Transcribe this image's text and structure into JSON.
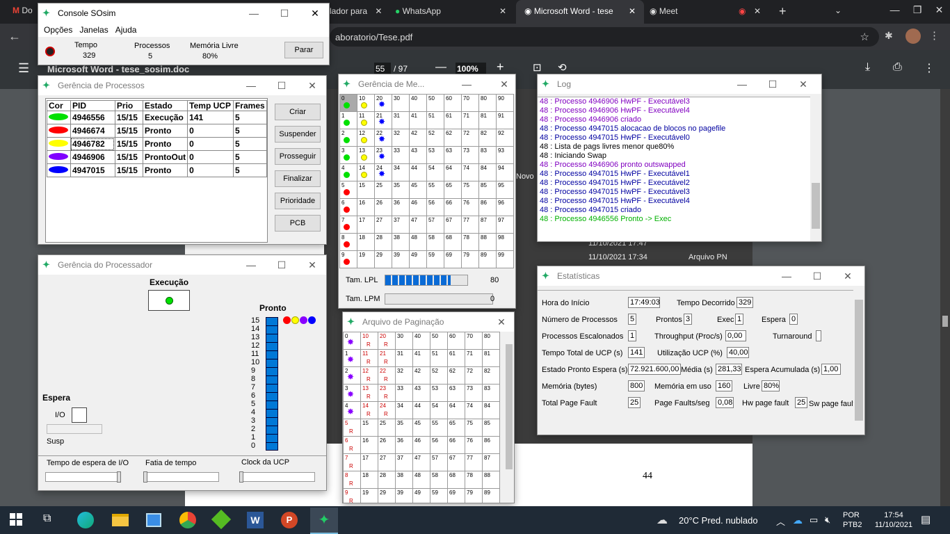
{
  "browser": {
    "tabs": [
      {
        "label": "Do"
      },
      {
        "label": "lador para"
      },
      {
        "label": "WhatsApp"
      },
      {
        "label": "Microsoft Word - tese"
      },
      {
        "label": "Meet"
      }
    ],
    "address": "aboratorio/Tese.pdf",
    "pdf": {
      "title": "Microsoft Word - tese_sosim.doc",
      "page": "55",
      "total": "/ 97",
      "zoom": "100%",
      "page_number": "44"
    }
  },
  "console": {
    "title": "Console SOsim",
    "menu": [
      "Opções",
      "Janelas",
      "Ajuda"
    ],
    "tempo_label": "Tempo",
    "tempo": "329",
    "processos_label": "Processos",
    "processos": "5",
    "memoria_label": "Memória Livre",
    "memoria": "80%",
    "parar": "Parar"
  },
  "gproc": {
    "title": "Gerência de Processos",
    "headers": [
      "Cor",
      "PID",
      "Prio",
      "Estado",
      "Temp UCP",
      "Frames"
    ],
    "rows": [
      {
        "color": "#00e000",
        "pid": "4946556",
        "prio": "15/15",
        "estado": "Execução",
        "ucp": "141",
        "frames": "5"
      },
      {
        "color": "#ff0000",
        "pid": "4946674",
        "prio": "15/15",
        "estado": "Pronto",
        "ucp": "0",
        "frames": "5"
      },
      {
        "color": "#ffff00",
        "pid": "4946782",
        "prio": "15/15",
        "estado": "Pronto",
        "ucp": "0",
        "frames": "5"
      },
      {
        "color": "#8000ff",
        "pid": "4946906",
        "prio": "15/15",
        "estado": "ProntoOut",
        "ucp": "0",
        "frames": "5"
      },
      {
        "color": "#0000ff",
        "pid": "4947015",
        "prio": "15/15",
        "estado": "Pronto",
        "ucp": "0",
        "frames": "5"
      }
    ],
    "buttons": [
      "Criar",
      "Suspender",
      "Prosseguir",
      "Finalizar",
      "Prioridade",
      "PCB"
    ]
  },
  "gcpu": {
    "title": "Gerência do Processador",
    "execucao": "Execução",
    "pronto": "Pronto",
    "espera": "Espera",
    "io": "I/O",
    "susp": "Susp",
    "levels": [
      "15",
      "14",
      "13",
      "12",
      "11",
      "10",
      "9",
      "8",
      "7",
      "6",
      "5",
      "4",
      "3",
      "2",
      "1",
      "0"
    ],
    "sliders": [
      "Tempo de espera de I/O",
      "Fatia de tempo",
      "Clock da UCP"
    ]
  },
  "gmem": {
    "title": "Gerência de Me...",
    "lpl": "Tam. LPL",
    "lpl_val": "80",
    "lpl_fill": 0.8,
    "lpm": "Tam. LPM",
    "lpm_val": "0",
    "lpm_fill": 0
  },
  "pag": {
    "title": "Arquivo de Paginação"
  },
  "log": {
    "title": "Log",
    "lines": [
      {
        "t": "48 : Processo 4946906 HwPF - Executável3",
        "c": "#8000c0"
      },
      {
        "t": "48 : Processo 4946906 HwPF - Executável4",
        "c": "#8000c0"
      },
      {
        "t": "48 : Processo 4946906 criado",
        "c": "#8000c0"
      },
      {
        "t": "48 : Processo 4947015 alocacao de blocos no pagefile",
        "c": "#0000a0"
      },
      {
        "t": "48 : Processo 4947015 HwPF - Executável0",
        "c": "#0000a0"
      },
      {
        "t": "48 : Lista de pags livres menor que80%",
        "c": "#000"
      },
      {
        "t": "48 : Iniciando Swap",
        "c": "#000"
      },
      {
        "t": "48 : Processo 4946906 pronto outswapped",
        "c": "#8000c0"
      },
      {
        "t": "48 : Processo 4947015 HwPF - Executável1",
        "c": "#0000a0"
      },
      {
        "t": "48 : Processo 4947015 HwPF - Executável2",
        "c": "#0000a0"
      },
      {
        "t": "48 : Processo 4947015 HwPF - Executável3",
        "c": "#0000a0"
      },
      {
        "t": "48 : Processo 4947015 HwPF - Executável4",
        "c": "#0000a0"
      },
      {
        "t": "48 : Processo 4947015 criado",
        "c": "#0000a0"
      },
      {
        "t": "48 : Processo 4946556 Pronto -> Exec",
        "c": "#00b000"
      }
    ]
  },
  "stats": {
    "title": "Estatísticas",
    "hora_label": "Hora do Início",
    "hora": "17:49:03",
    "decorrido_label": "Tempo Decorrido",
    "decorrido": "329",
    "nproc_label": "Número de Processos",
    "nproc": "5",
    "prontos_label": "Prontos",
    "prontos": "3",
    "exec_label": "Exec",
    "exec": "1",
    "espera_label": "Espera",
    "espera": "0",
    "escal_label": "Processos Escalonados",
    "escal": "1",
    "through_label": "Throughput (Proc/s)",
    "through": "0,00",
    "turn_label": "Turnaround",
    "turn": "",
    "ttucp_label": "Tempo Total de UCP (s)",
    "ttucp": "141",
    "utilucp_label": "Utilização UCP (%)",
    "utilucp": "40,00",
    "epe_label": "Estado Pronto Espera (s)",
    "epe": "72.921.600,00",
    "media_label": "Média (s)",
    "media": "281,33",
    "esp_acum_label": "Espera Acumulada (s)",
    "esp_acum": "1,00",
    "mem_label": "Memória (bytes)",
    "mem": "800",
    "memuso_label": "Memória em uso",
    "memuso": "160",
    "livre_label": "Livre",
    "livre": "80%",
    "tpf_label": "Total Page Fault",
    "tpf": "25",
    "pfs_label": "Page Faults/seg",
    "pfs": "0,08",
    "hwpf_label": "Hw page fault",
    "hwpf": "25",
    "swpf_label": "Sw page fault"
  },
  "bg": {
    "r1": "11/10/2021 17:47",
    "r2": "11/10/2021 17:34",
    "arq": "Arquivo PN",
    "novo": "Novo"
  },
  "taskbar": {
    "weather": "20°C  Pred. nublado",
    "lang1": "POR",
    "lang2": "PTB2",
    "time": "17:54",
    "date": "11/10/2021"
  }
}
